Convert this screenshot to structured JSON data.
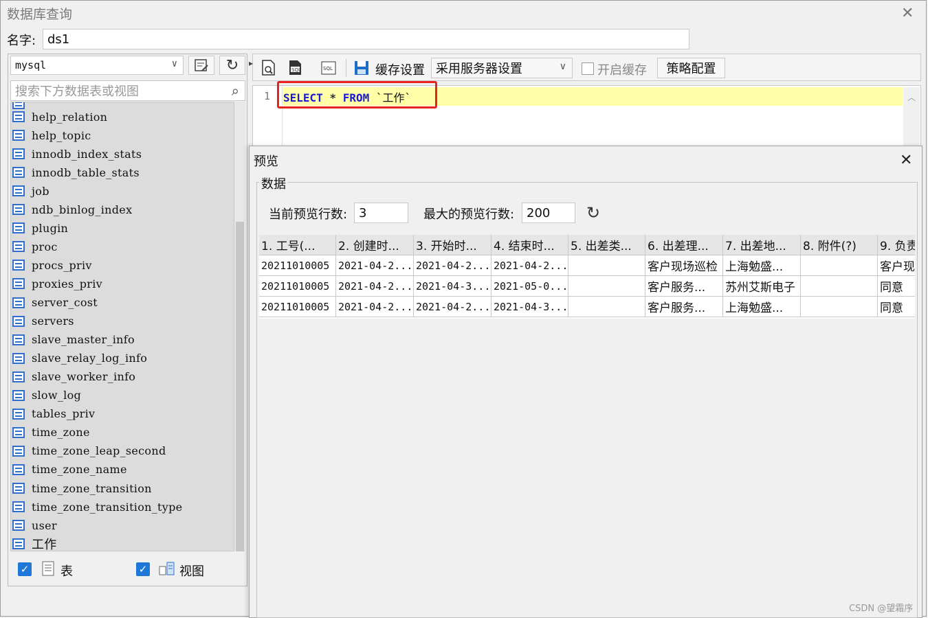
{
  "window": {
    "title": "数据库查询"
  },
  "name_field": {
    "label": "名字:",
    "value": "ds1"
  },
  "left_panel": {
    "db_select": "mysql",
    "search_placeholder": "搜索下方数据表或视图",
    "tables": [
      "help_relation",
      "help_topic",
      "innodb_index_stats",
      "innodb_table_stats",
      "job",
      "ndb_binlog_index",
      "plugin",
      "proc",
      "procs_priv",
      "proxies_priv",
      "server_cost",
      "servers",
      "slave_master_info",
      "slave_relay_log_info",
      "slave_worker_info",
      "slow_log",
      "tables_priv",
      "time_zone",
      "time_zone_leap_second",
      "time_zone_name",
      "time_zone_transition",
      "time_zone_transition_type",
      "user",
      "工作"
    ],
    "filter_table_label": "表",
    "filter_view_label": "视图"
  },
  "toolbar": {
    "cache_label": "缓存设置",
    "cache_select": "采用服务器设置",
    "enable_cache_label": "开启缓存",
    "strategy_button": "策略配置"
  },
  "editor": {
    "line_number": "1",
    "kw_select": "SELECT",
    "star": "*",
    "kw_from": "FROM",
    "table_ref": "`工作`"
  },
  "preview": {
    "title": "预览",
    "group_label": "数据",
    "current_rows_label": "当前预览行数:",
    "current_rows_value": "3",
    "max_rows_label": "最大的预览行数:",
    "max_rows_value": "200",
    "headers": [
      "1. 工号(...",
      "2. 创建时...",
      "3. 开始时...",
      "4. 结束时...",
      "5. 出差类...",
      "6. 出差理...",
      "7. 出差地...",
      "8. 附件(?)",
      "9. 负责"
    ],
    "rows": [
      [
        "20211010005",
        "2021-04-2...",
        "2021-04-2...",
        "2021-04-2...",
        "",
        "客户现场巡检",
        "上海勉盛...",
        "",
        "客户现"
      ],
      [
        "20211010005",
        "2021-04-2...",
        "2021-04-3...",
        "2021-05-0...",
        "",
        "客户服务...",
        "苏州艾斯电子",
        "",
        "同意"
      ],
      [
        "20211010005",
        "2021-04-2...",
        "2021-04-2...",
        "2021-04-3...",
        "",
        "客户服务...",
        "上海勉盛...",
        "",
        "同意"
      ]
    ]
  },
  "watermark": "CSDN @望霜序"
}
